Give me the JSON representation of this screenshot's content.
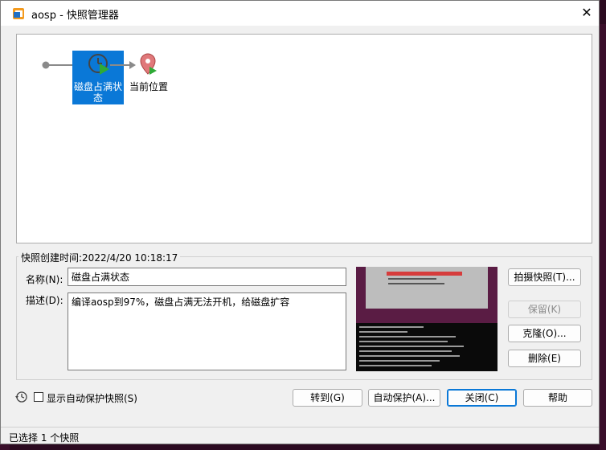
{
  "window": {
    "title": "aosp - 快照管理器",
    "close_glyph": "✕"
  },
  "tree": {
    "snapshot_label": "磁盘占满状态",
    "current_label": "当前位置"
  },
  "details": {
    "created": "快照创建时间:2022/4/20 10:18:17",
    "name_label": "名称(N):",
    "name_value": "磁盘占满状态",
    "desc_label": "描述(D):",
    "desc_value": "编译aosp到97%，磁盘占满无法开机，给磁盘扩容"
  },
  "side_buttons": {
    "take": "拍摄快照(T)...",
    "keep": "保留(K)",
    "clone": "克隆(O)...",
    "delete": "删除(E)"
  },
  "footer": {
    "show_auto": "显示自动保护快照(S)",
    "goto": "转到(G)",
    "autoprotect": "自动保护(A)...",
    "close": "关闭(C)",
    "help": "帮助"
  },
  "status": "已选择 1 个快照",
  "colors": {
    "selection": "#0a78d7",
    "accent_green": "#2eaa36",
    "pin": "#e0787a"
  }
}
